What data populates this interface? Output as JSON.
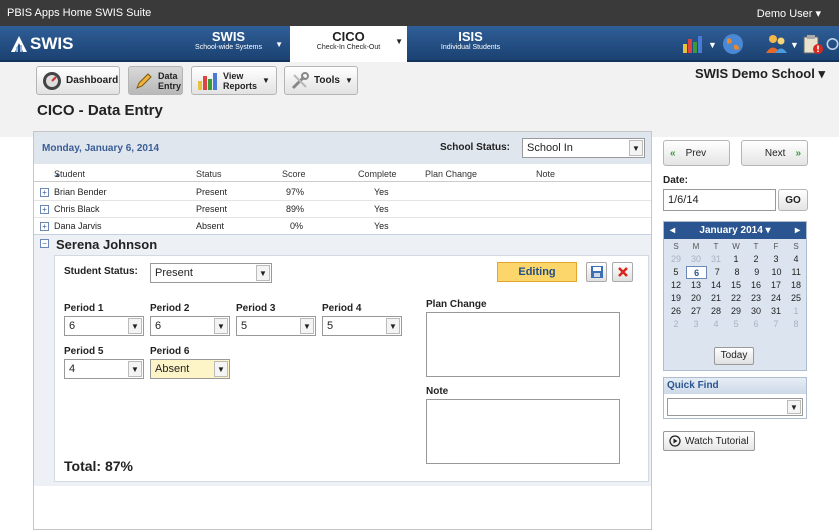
{
  "topbar": {
    "home_link": "PBIS Apps Home",
    "suite_link": "SWIS Suite",
    "user": "Demo User"
  },
  "nav": {
    "logo": "SWIS",
    "tabs": [
      {
        "title": "SWIS",
        "subtitle": "School-wide Systems"
      },
      {
        "title": "CICO",
        "subtitle": "Check-In Check-Out"
      },
      {
        "title": "ISIS",
        "subtitle": "Individual Students"
      }
    ],
    "icons": [
      "reports-icon",
      "globe-icon",
      "users-icon",
      "alerts-icon",
      "logout-icon"
    ]
  },
  "toolbar": {
    "dashboard": "Dashboard",
    "data_entry_1": "Data",
    "data_entry_2": "Entry",
    "view_reports_1": "View",
    "view_reports_2": "Reports",
    "tools": "Tools",
    "school": "SWIS Demo School",
    "page_title": "CICO - Data Entry"
  },
  "panel": {
    "date": "Monday, January 6, 2014",
    "school_status_label": "School Status:",
    "school_status_value": "School In",
    "columns": {
      "student": "Student",
      "status": "Status",
      "score": "Score",
      "complete": "Complete",
      "plan_change": "Plan Change",
      "note": "Note"
    },
    "rows": [
      {
        "student": "Brian Bender",
        "status": "Present",
        "score": "97%",
        "complete": "Yes"
      },
      {
        "student": "Chris Black",
        "status": "Present",
        "score": "89%",
        "complete": "Yes"
      },
      {
        "student": "Dana Jarvis",
        "status": "Absent",
        "score": "0%",
        "complete": "Yes"
      }
    ],
    "edit": {
      "student": "Serena Johnson",
      "status_label": "Student Status:",
      "status_value": "Present",
      "badge": "Editing",
      "periods": [
        {
          "label": "Period 1",
          "value": "6"
        },
        {
          "label": "Period 2",
          "value": "6"
        },
        {
          "label": "Period 3",
          "value": "5"
        },
        {
          "label": "Period 4",
          "value": "5"
        },
        {
          "label": "Period 5",
          "value": "4"
        },
        {
          "label": "Period 6",
          "value": "Absent"
        }
      ],
      "plan_change_label": "Plan Change",
      "note_label": "Note",
      "total": "Total:  87%"
    }
  },
  "sidebar": {
    "prev": "Prev",
    "next": "Next",
    "date_label": "Date:",
    "date_value": "1/6/14",
    "go": "GO",
    "calendar": {
      "month": "January 2014",
      "weekdays": [
        "S",
        "M",
        "T",
        "W",
        "T",
        "F",
        "S"
      ],
      "weeks": [
        [
          "29",
          "30",
          "31",
          "1",
          "2",
          "3",
          "4"
        ],
        [
          "5",
          "6",
          "7",
          "8",
          "9",
          "10",
          "11"
        ],
        [
          "12",
          "13",
          "14",
          "15",
          "16",
          "17",
          "18"
        ],
        [
          "19",
          "20",
          "21",
          "22",
          "23",
          "24",
          "25"
        ],
        [
          "26",
          "27",
          "28",
          "29",
          "30",
          "31",
          "1"
        ],
        [
          "2",
          "3",
          "4",
          "5",
          "6",
          "7",
          "8"
        ]
      ],
      "selected": "6",
      "today": "Today"
    },
    "quick_find": "Quick Find",
    "tutorial": "Watch Tutorial"
  },
  "colors": {
    "nav": "#1f4a80",
    "accent": "#2a5590",
    "editing": "#fcd66a",
    "delete": "#d9251d"
  }
}
